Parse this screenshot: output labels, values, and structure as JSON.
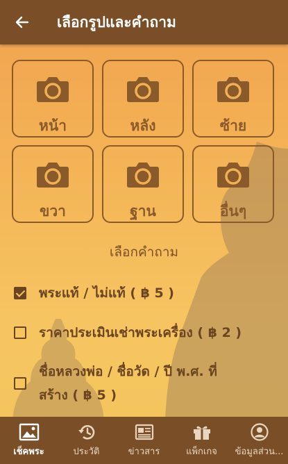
{
  "header": {
    "title": "เลือกรูปและคำถาม",
    "back_icon": "arrow-left-icon"
  },
  "photo_slots": [
    {
      "label": "หน้า",
      "icon": "camera-icon"
    },
    {
      "label": "หลัง",
      "icon": "camera-icon"
    },
    {
      "label": "ซ้าย",
      "icon": "camera-icon"
    },
    {
      "label": "ขวา",
      "icon": "camera-icon"
    },
    {
      "label": "ฐาน",
      "icon": "camera-icon"
    },
    {
      "label": "อื่นๆ",
      "icon": "camera-icon"
    }
  ],
  "questions": {
    "title": "เลือกคำถาม",
    "options": [
      {
        "label": "พระแท้ / ไม่แท้ ( ฿ 5 )",
        "checked": true
      },
      {
        "label": "ราคาประเมินเช่าพระเครื่อง ( ฿ 2 )",
        "checked": false
      },
      {
        "line1": "ชื่อหลวงพ่อ / ชื่อวัด / ปี พ.ศ. ที่",
        "line2": "สร้าง ( ฿ 5 )",
        "checked": false
      }
    ]
  },
  "bottom_nav": [
    {
      "label": "เช็คพระ",
      "icon": "image-icon",
      "active": true
    },
    {
      "label": "ประวัติ",
      "icon": "history-icon",
      "active": false
    },
    {
      "label": "ข่าวสาร",
      "icon": "news-icon",
      "active": false
    },
    {
      "label": "แพ็กเกจ",
      "icon": "gift-icon",
      "active": false
    },
    {
      "label": "ข้อมูลส่วน...",
      "icon": "account-icon",
      "active": false
    }
  ],
  "colors": {
    "header": "#7a4e27",
    "accent": "#8a5a2b",
    "background_top": "#f1a24e",
    "background_bottom": "#f6c561"
  }
}
